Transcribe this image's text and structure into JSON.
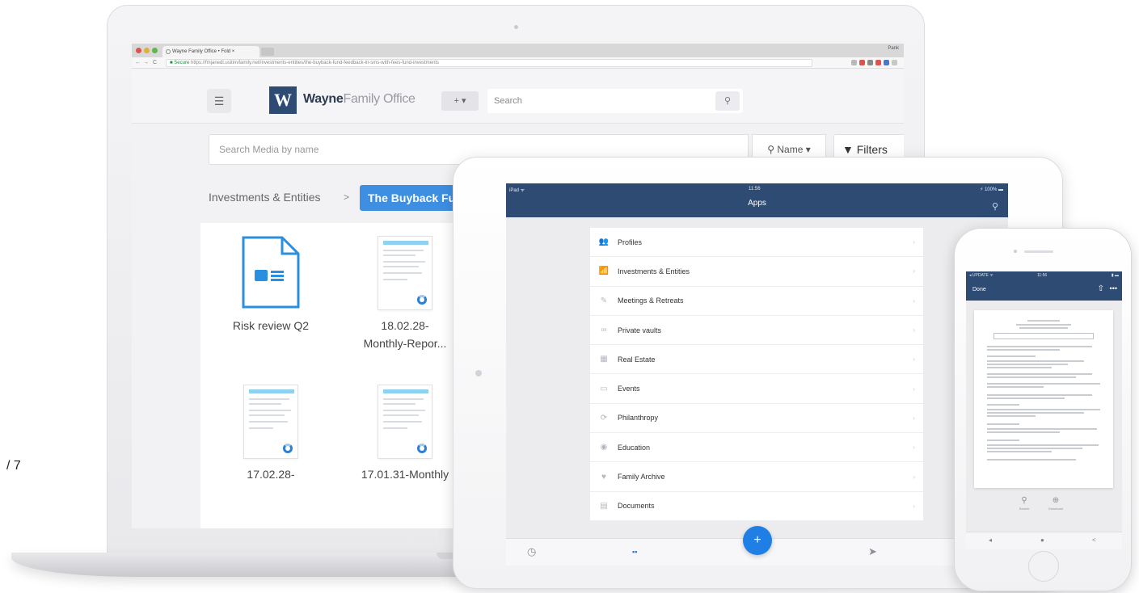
{
  "browser": {
    "tab_title": "Wayne Family Office • Fold ×",
    "user_label": "Pank",
    "nav": {
      "back": "←",
      "forward": "→",
      "reload": "C"
    },
    "url_secure": "■ Secure",
    "url": "https://fmjanedl.usitinvfamily.net/investments-entities/the-buyback-fund-feedback-in-sms-with-fees-fund-investments"
  },
  "header": {
    "menu_icon": "☰",
    "logo_letter": "W",
    "brand_bold": "Wayne",
    "brand_light": "Family Office",
    "add_label": "+ ▾",
    "search_placeholder": "Search",
    "search_icon": "⚲"
  },
  "media_search": {
    "placeholder": "Search Media by name",
    "sort_label": "⚲ Name  ▾",
    "filters_label": "Filters",
    "filters_icon": "▼"
  },
  "breadcrumb": {
    "parent": "Investments & Entities",
    "separator": ">",
    "current": "The Buyback Fund"
  },
  "files": [
    {
      "name": "Risk review Q2",
      "name2": ""
    },
    {
      "name": "18.02.28-",
      "name2": "Monthly-Repor..."
    },
    {
      "name": "17.02.28-",
      "name2": ""
    },
    {
      "name": "17.01.31-Monthly",
      "name2": ""
    }
  ],
  "page_count": "/ 7",
  "tablet": {
    "status_left": "iPad ᯤ",
    "status_time": "11:56",
    "status_right": "⚡ 100% ▬",
    "title": "Apps",
    "search_icon": "⚲",
    "items": [
      {
        "label": "Profiles",
        "icon": "👥"
      },
      {
        "label": "Investments & Entities",
        "icon": "📶"
      },
      {
        "label": "Meetings & Retreats",
        "icon": "✎"
      },
      {
        "label": "Private vaults",
        "icon": "∞"
      },
      {
        "label": "Real Estate",
        "icon": "▦"
      },
      {
        "label": "Events",
        "icon": "▭"
      },
      {
        "label": "Philanthropy",
        "icon": "⟳"
      },
      {
        "label": "Education",
        "icon": "◉"
      },
      {
        "label": "Family Archive",
        "icon": "♥"
      },
      {
        "label": "Documents",
        "icon": "▤"
      }
    ],
    "chevron": "›",
    "tabbar": {
      "history": "◷",
      "apps": "▪▪",
      "add": "+",
      "send": "➤"
    }
  },
  "phone": {
    "status_left": "◂ UPDATE ᯤ",
    "status_time": "11:56",
    "status_right": "▮ ▬",
    "done_label": "Done",
    "share_icon": "⇧",
    "more_icon": "•••",
    "tools": [
      {
        "icon": "⚲",
        "label": "Search"
      },
      {
        "icon": "⊕",
        "label": "Download"
      }
    ],
    "bottom": {
      "back": "◂",
      "home": "●",
      "share": "<"
    }
  },
  "colors": {
    "brand_navy": "#2e4b74",
    "accent_blue": "#3e8ee2",
    "fab_blue": "#1f7fe4"
  }
}
